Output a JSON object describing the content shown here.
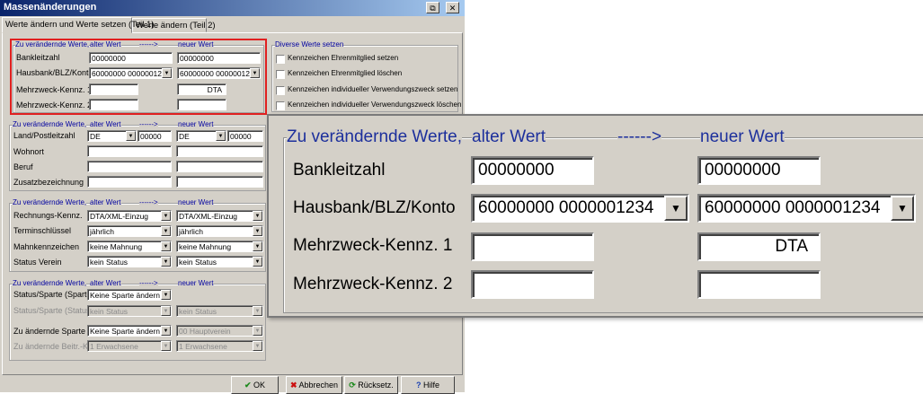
{
  "window": {
    "title": "Massenänderungen",
    "restore_glyph": "⧉",
    "close_glyph": "✕"
  },
  "tabs": [
    {
      "label": "Werte ändern und Werte setzen (Teil 1)",
      "selected": true
    },
    {
      "label": "Werte ändern (Teil 2)",
      "selected": false
    }
  ],
  "common": {
    "group_title": "Zu verändernde Werte,",
    "old": "alter Wert",
    "arrow": "------>",
    "new": "neuer Wert",
    "dd_glyph": "▼"
  },
  "group1": {
    "rows": [
      {
        "label": "Bankleitzahl",
        "old": "00000000",
        "new": "00000000"
      },
      {
        "label": "Hausbank/BLZ/Konto",
        "old": "60000000  0000001234",
        "new": "60000000  0000001234"
      },
      {
        "label": "Mehrzweck-Kennz. 1",
        "old": "",
        "new": "DTA"
      },
      {
        "label": "Mehrzweck-Kennz. 2",
        "old": "",
        "new": ""
      }
    ]
  },
  "diverse": {
    "title": "Diverse Werte setzen",
    "items": [
      "Kennzeichen Ehrenmitglied setzen",
      "Kennzeichen Ehrenmitglied löschen",
      "Kennzeichen individueller Verwendungszweck setzen",
      "Kennzeichen individueller Verwendungszweck löschen"
    ]
  },
  "group2": {
    "rows": [
      {
        "label": "Land/Postleitzahl",
        "old_country": "DE",
        "old_plz": "00000",
        "new_country": "DE",
        "new_plz": "00000"
      },
      {
        "label": "Wohnort"
      },
      {
        "label": "Beruf"
      },
      {
        "label": "Zusatzbezeichnung"
      }
    ]
  },
  "group3": {
    "rows": [
      {
        "label": "Rechnungs-Kennz.",
        "old": "DTA/XML-Einzug",
        "new": "DTA/XML-Einzug"
      },
      {
        "label": "Terminschlüssel",
        "old": "jährlich",
        "new": "jährlich"
      },
      {
        "label": "Mahnkennzeichen",
        "old": "keine Mahnung",
        "new": "keine Mahnung"
      },
      {
        "label": "Status Verein",
        "old": "kein Status",
        "new": "kein Status"
      }
    ]
  },
  "group4": {
    "rows": [
      {
        "label": "Status/Sparte (Sparte)",
        "old": "Keine Sparte ändern"
      },
      {
        "label": "Status/Sparte (Status)",
        "old": "kein Status",
        "new": "kein Status"
      },
      {
        "label": "Zu ändernde Sparte",
        "old": "Keine Sparte ändern",
        "new": "00  Hauptverein"
      },
      {
        "label": "Zu ändernde Beitr.-Kl.",
        "old": "1  Erwachsene",
        "new": "1  Erwachsene"
      }
    ]
  },
  "buttons": {
    "ok": "OK",
    "cancel": "Abbrechen",
    "reset": "Rücksetz.",
    "help": "Hilfe"
  }
}
